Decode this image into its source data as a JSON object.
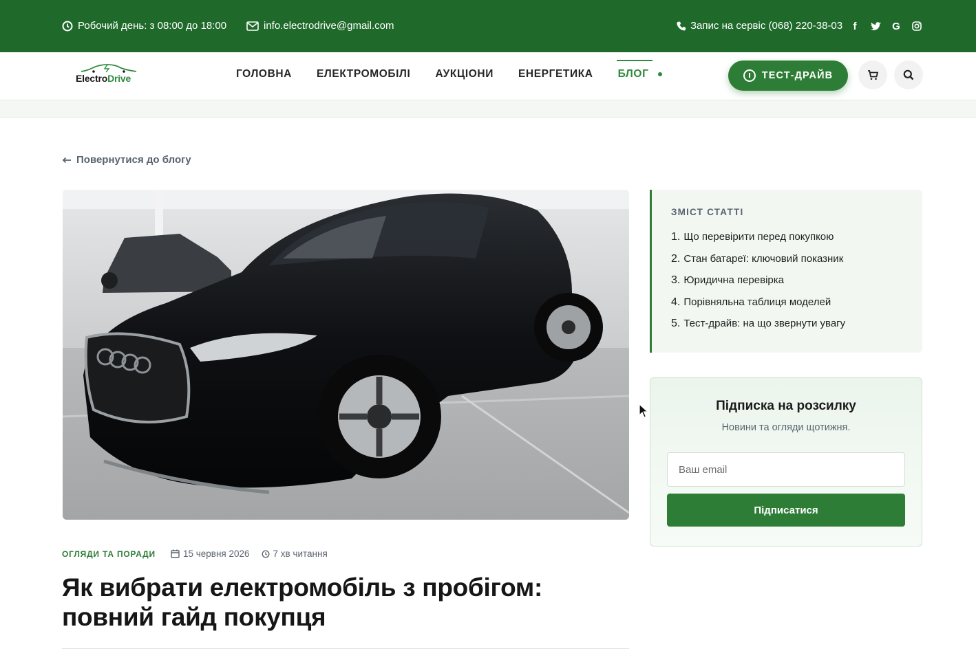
{
  "topbar": {
    "hours": "Робочий день: з 08:00 до 18:00",
    "email": "info.electrodrive@gmail.com",
    "phone": "Запис на сервіс (068) 220-38-03",
    "social": [
      "facebook-icon",
      "twitter-icon",
      "google-icon",
      "instagram-icon"
    ]
  },
  "logo": {
    "part1": "Electro",
    "part2": "Drive"
  },
  "nav": {
    "items": [
      {
        "label": "ГОЛОВНА"
      },
      {
        "label": "ЕЛЕКТРОМОБІЛІ"
      },
      {
        "label": "АУКЦІОНИ"
      },
      {
        "label": "ЕНЕРГЕТИКА"
      },
      {
        "label": "БЛОГ",
        "active": true
      }
    ]
  },
  "header": {
    "test_drive_label": "ТЕСТ-ДРАЙВ"
  },
  "back_label": "Повернутися до блогу",
  "article": {
    "category": "ОГЛЯДИ ТА ПОРАДИ",
    "date": "15 червня 2026",
    "read_time": "7 хв читання",
    "title": "Як вибрати електромобіль з пробігом: повний гайд покупця"
  },
  "toc": {
    "heading": "ЗМІСТ СТАТТІ",
    "items": [
      {
        "num": "1.",
        "label": "Що перевірити перед покупкою"
      },
      {
        "num": "2.",
        "label": "Стан батареї: ключовий показник"
      },
      {
        "num": "3.",
        "label": "Юридична перевірка"
      },
      {
        "num": "4.",
        "label": "Порівняльна таблиця моделей"
      },
      {
        "num": "5.",
        "label": "Тест-драйв: на що звернути увагу"
      }
    ]
  },
  "newsletter": {
    "title": "Підписка на розсилку",
    "subtitle": "Новини та огляди щотижня.",
    "placeholder": "Ваш email",
    "button": "Підписатися"
  },
  "colors": {
    "brand": "#1f6a2b",
    "accent": "#2e7d36"
  }
}
